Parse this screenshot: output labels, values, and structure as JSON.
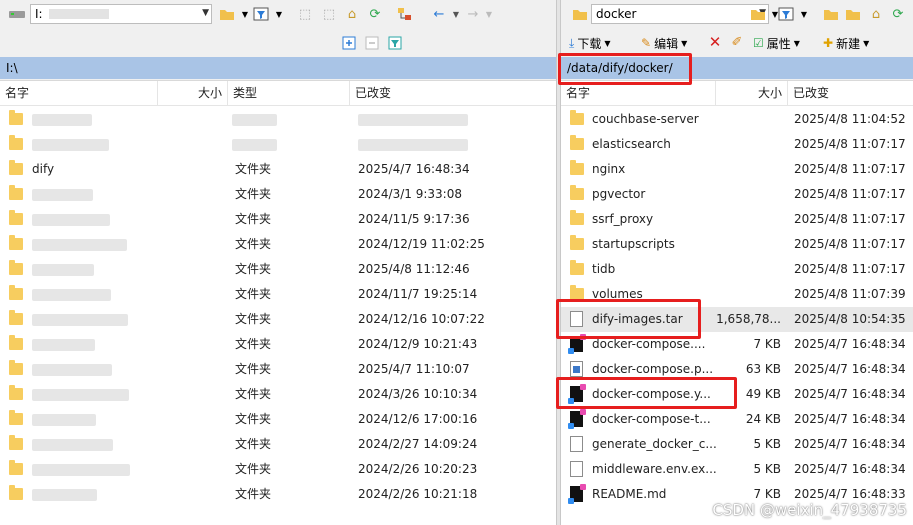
{
  "left": {
    "drive_label": "I:",
    "path": "I:\\",
    "columns": {
      "name": "名字",
      "size": "大小",
      "type": "类型",
      "modified": "已改变"
    },
    "rows": [
      {
        "name": "",
        "type": "",
        "modified": "",
        "folder": true,
        "blurred": true
      },
      {
        "name": "",
        "type": "",
        "modified": "",
        "folder": true,
        "blurred": true
      },
      {
        "name": "dify",
        "type": "文件夹",
        "modified": "2025/4/7 16:48:34",
        "folder": true,
        "blurred": false
      },
      {
        "name": "",
        "type": "文件夹",
        "modified": "2024/3/1 9:33:08",
        "folder": true,
        "blurred": true
      },
      {
        "name": "",
        "type": "文件夹",
        "modified": "2024/11/5 9:17:36",
        "folder": true,
        "blurred": true
      },
      {
        "name": "",
        "type": "文件夹",
        "modified": "2024/12/19 11:02:25",
        "folder": true,
        "blurred": true
      },
      {
        "name": "",
        "type": "文件夹",
        "modified": "2025/4/8 11:12:46",
        "folder": true,
        "blurred": true
      },
      {
        "name": "",
        "type": "文件夹",
        "modified": "2024/11/7 19:25:14",
        "folder": true,
        "blurred": true
      },
      {
        "name": "",
        "type": "文件夹",
        "modified": "2024/12/16 10:07:22",
        "folder": true,
        "blurred": true
      },
      {
        "name": "",
        "type": "文件夹",
        "modified": "2024/12/9 10:21:43",
        "folder": true,
        "blurred": true
      },
      {
        "name": "",
        "type": "文件夹",
        "modified": "2025/4/7 11:10:07",
        "folder": true,
        "blurred": true
      },
      {
        "name": "",
        "type": "文件夹",
        "modified": "2024/3/26 10:10:34",
        "folder": true,
        "blurred": true
      },
      {
        "name": "",
        "type": "文件夹",
        "modified": "2024/12/6 17:00:16",
        "folder": true,
        "blurred": true
      },
      {
        "name": "",
        "type": "文件夹",
        "modified": "2024/2/27 14:09:24",
        "folder": true,
        "blurred": true
      },
      {
        "name": "",
        "type": "文件夹",
        "modified": "2024/2/26 10:20:23",
        "folder": true,
        "blurred": true
      },
      {
        "name": "",
        "type": "文件夹",
        "modified": "2024/2/26 10:21:18",
        "folder": true,
        "blurred": true
      }
    ]
  },
  "right": {
    "folder_combo": "docker",
    "path": "/data/dify/docker/",
    "toolbar": {
      "download": "下载",
      "edit": "编辑",
      "properties": "属性",
      "new": "新建"
    },
    "columns": {
      "name": "名字",
      "size": "大小",
      "modified": "已改变"
    },
    "rows": [
      {
        "name": "couchbase-server",
        "size": "",
        "modified": "2025/4/8 11:04:52",
        "icon": "folder"
      },
      {
        "name": "elasticsearch",
        "size": "",
        "modified": "2025/4/8 11:07:17",
        "icon": "folder"
      },
      {
        "name": "nginx",
        "size": "",
        "modified": "2025/4/8 11:07:17",
        "icon": "folder"
      },
      {
        "name": "pgvector",
        "size": "",
        "modified": "2025/4/8 11:07:17",
        "icon": "folder"
      },
      {
        "name": "ssrf_proxy",
        "size": "",
        "modified": "2025/4/8 11:07:17",
        "icon": "folder"
      },
      {
        "name": "startupscripts",
        "size": "",
        "modified": "2025/4/8 11:07:17",
        "icon": "folder"
      },
      {
        "name": "tidb",
        "size": "",
        "modified": "2025/4/8 11:07:17",
        "icon": "folder"
      },
      {
        "name": "volumes",
        "size": "",
        "modified": "2025/4/8 11:07:39",
        "icon": "folder"
      },
      {
        "name": "dify-images.tar",
        "size": "1,658,78...",
        "modified": "2025/4/8 10:54:35",
        "icon": "blank"
      },
      {
        "name": "docker-compose....",
        "size": "7 KB",
        "modified": "2025/4/7 16:48:34",
        "icon": "ij"
      },
      {
        "name": "docker-compose.p...",
        "size": "63 KB",
        "modified": "2025/4/7 16:48:34",
        "icon": "py"
      },
      {
        "name": "docker-compose.y...",
        "size": "49 KB",
        "modified": "2025/4/7 16:48:34",
        "icon": "ij"
      },
      {
        "name": "docker-compose-t...",
        "size": "24 KB",
        "modified": "2025/4/7 16:48:34",
        "icon": "ij"
      },
      {
        "name": "generate_docker_c...",
        "size": "5 KB",
        "modified": "2025/4/7 16:48:34",
        "icon": "blank"
      },
      {
        "name": "middleware.env.ex...",
        "size": "5 KB",
        "modified": "2025/4/7 16:48:34",
        "icon": "blank"
      },
      {
        "name": "README.md",
        "size": "7 KB",
        "modified": "2025/4/7 16:48:33",
        "icon": "ij"
      }
    ]
  },
  "watermark": "CSDN @weixin_47938735",
  "colors": {
    "pathbar": "#a9c4e6",
    "highlight_box": "#e61e1e",
    "folder": "#f7cd5f"
  }
}
